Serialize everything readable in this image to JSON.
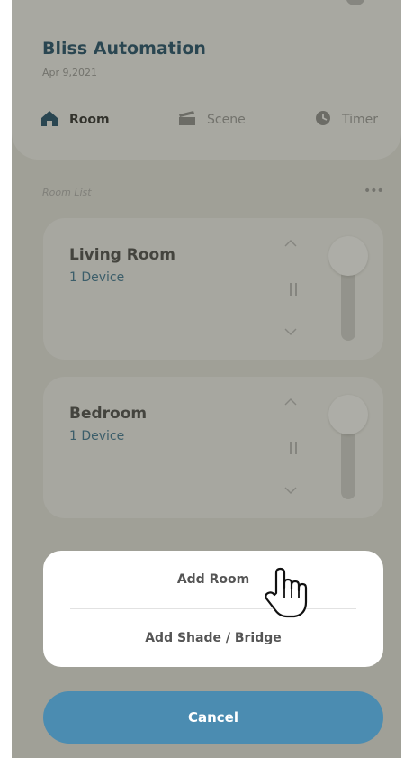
{
  "app": {
    "title": "Bliss Automation",
    "date": "Apr 9,2021"
  },
  "tabs": [
    {
      "label": "Room",
      "icon": "home-icon",
      "active": true
    },
    {
      "label": "Scene",
      "icon": "clapperboard-icon",
      "active": false
    },
    {
      "label": "Timer",
      "icon": "clock-icon",
      "active": false
    }
  ],
  "room_list": {
    "label": "Room List",
    "more_icon": "more-dots-icon",
    "rooms": [
      {
        "name": "Living Room",
        "devices": "1 Device"
      },
      {
        "name": "Bedroom",
        "devices": "1 Device"
      }
    ]
  },
  "action_sheet": {
    "add_room": "Add Room",
    "add_shade": "Add Shade / Bridge",
    "cancel": "Cancel"
  },
  "colors": {
    "brand_dark": "#1e4e6b",
    "accent": "#4b8cb1",
    "device_text": "#3d7797"
  }
}
